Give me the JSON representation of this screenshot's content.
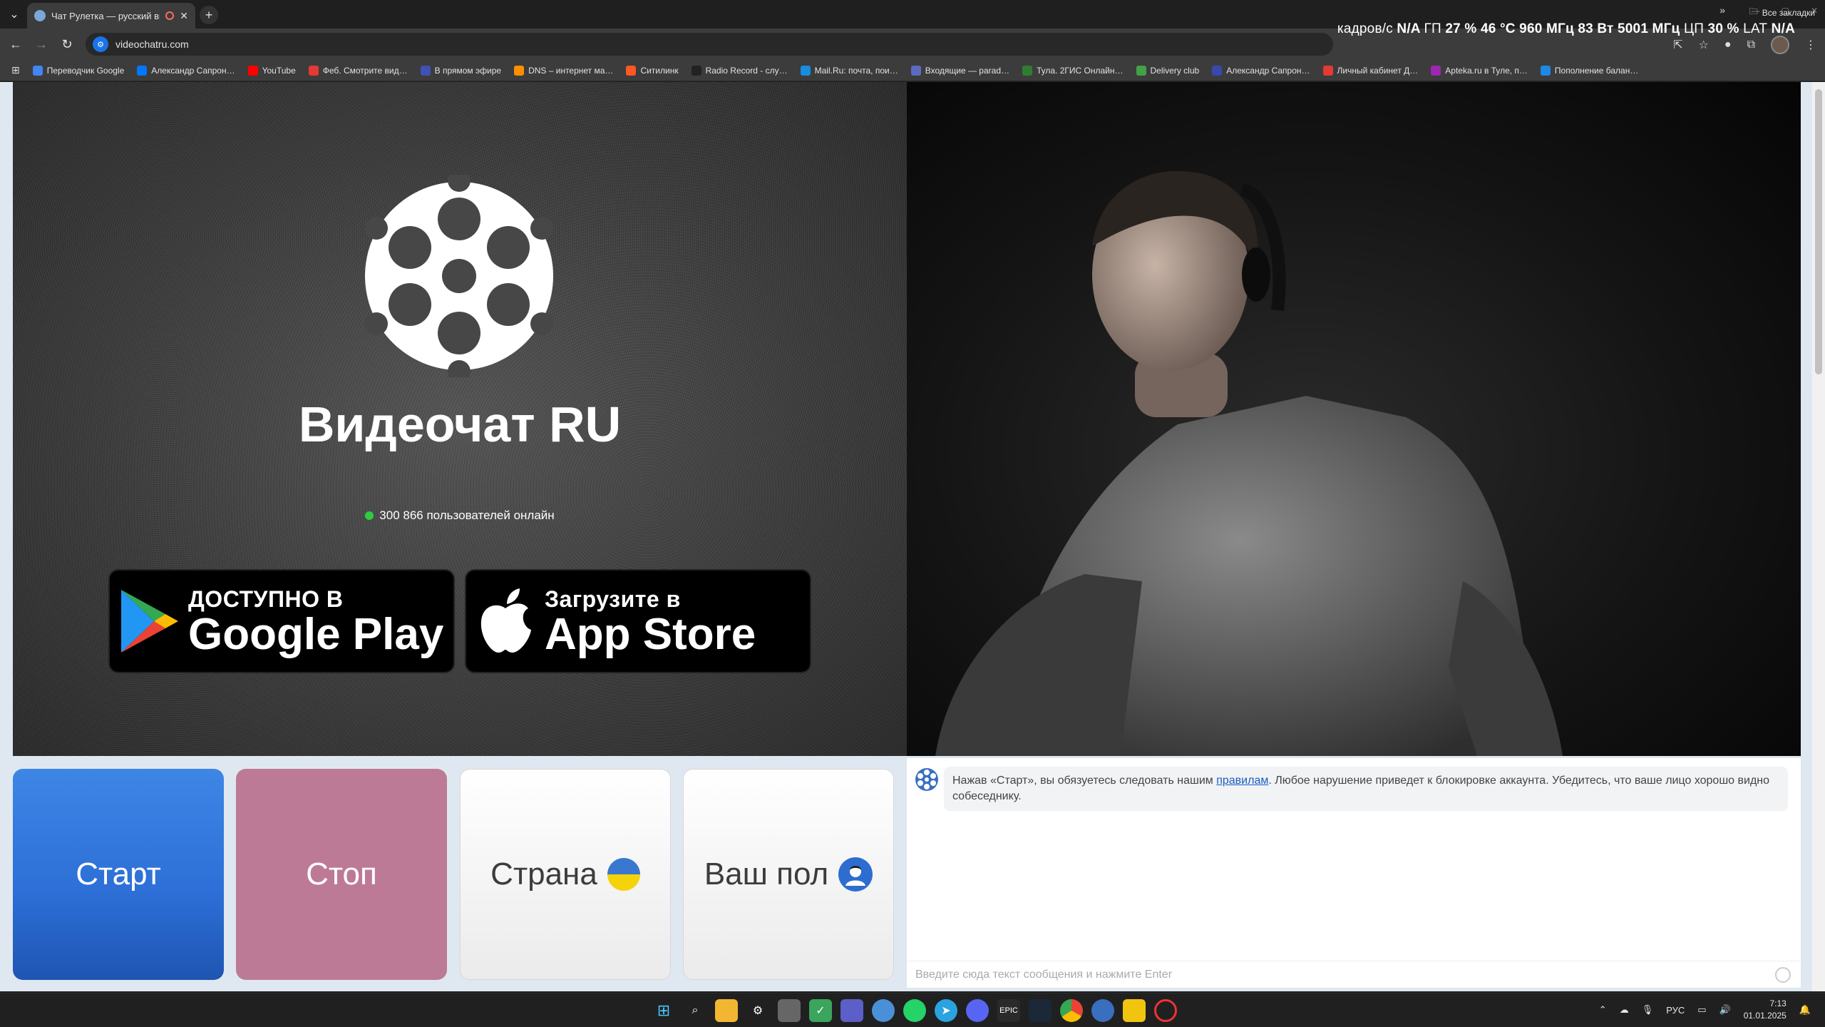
{
  "browser": {
    "tab_title": "Чат Рулетка — русский ви…",
    "url": "videochatru.com",
    "new_tab_label": "+",
    "close_tab": "✕"
  },
  "osd": {
    "fps_label": "кадров/с",
    "fps_value": "N/A",
    "gpu_label": "ГП",
    "gpu_load": "27 %",
    "gpu_temp": "46 °C",
    "gpu_clock": "960 МГц",
    "gpu_power": "83 Вт",
    "mem_clock": "5001 МГц",
    "cpu_label": "ЦП",
    "cpu_load": "30 %",
    "lat_label": "LAT",
    "lat_value": "N/A"
  },
  "bookmarks": [
    {
      "label": "Переводчик Google",
      "color": "#4285f4"
    },
    {
      "label": "Александр Сапрон…",
      "color": "#0077ff"
    },
    {
      "label": "YouTube",
      "color": "#ff0000"
    },
    {
      "label": "Феб. Смотрите вид…",
      "color": "#e53935"
    },
    {
      "label": "В прямом эфире",
      "color": "#3f51b5"
    },
    {
      "label": "DNS – интернет ма…",
      "color": "#ff8f00"
    },
    {
      "label": "Ситилинк",
      "color": "#ff5722"
    },
    {
      "label": "Radio Record - слу…",
      "color": "#222222"
    },
    {
      "label": "Mail.Ru: почта, пои…",
      "color": "#168de2"
    },
    {
      "label": "Входящие — parad…",
      "color": "#5c6bc0"
    },
    {
      "label": "Тула. 2ГИС Онлайн…",
      "color": "#2e7d32"
    },
    {
      "label": "Delivery club",
      "color": "#43a047"
    },
    {
      "label": "Александр Сапрон…",
      "color": "#3949ab"
    },
    {
      "label": "Личный кабинет Д…",
      "color": "#e53935"
    },
    {
      "label": "Apteka.ru в Туле, п…",
      "color": "#9c27b0"
    },
    {
      "label": "Пополнение балан…",
      "color": "#1e88e5"
    }
  ],
  "bookmarks_more": "»",
  "bookmarks_all": "Все закладки",
  "page": {
    "brand": "Видеочат RU",
    "online_text": "300 866 пользователей онлайн",
    "google_play": {
      "small": "ДОСТУПНО В",
      "big": "Google Play"
    },
    "app_store": {
      "small": "Загрузите в",
      "big": "App Store"
    }
  },
  "controls": {
    "start": "Старт",
    "stop": "Стоп",
    "country": "Страна",
    "gender": "Ваш пол"
  },
  "chat": {
    "message_before": "Нажав «Старт», вы обязуетесь следовать нашим ",
    "message_link": "правилам",
    "message_after": ". Любое нарушение приведет к блокировке аккаунта. Убедитесь, что ваше лицо хорошо видно собеседнику.",
    "input_placeholder": "Введите сюда текст сообщения и нажмите Enter"
  },
  "taskbar": {
    "lang": "РУС",
    "time": "7:13",
    "date": "01.01.2025"
  },
  "colors": {
    "start": "#2c6ed6",
    "stop": "#bd7a96",
    "online_dot": "#2ecc40",
    "link": "#1a5cc0"
  }
}
